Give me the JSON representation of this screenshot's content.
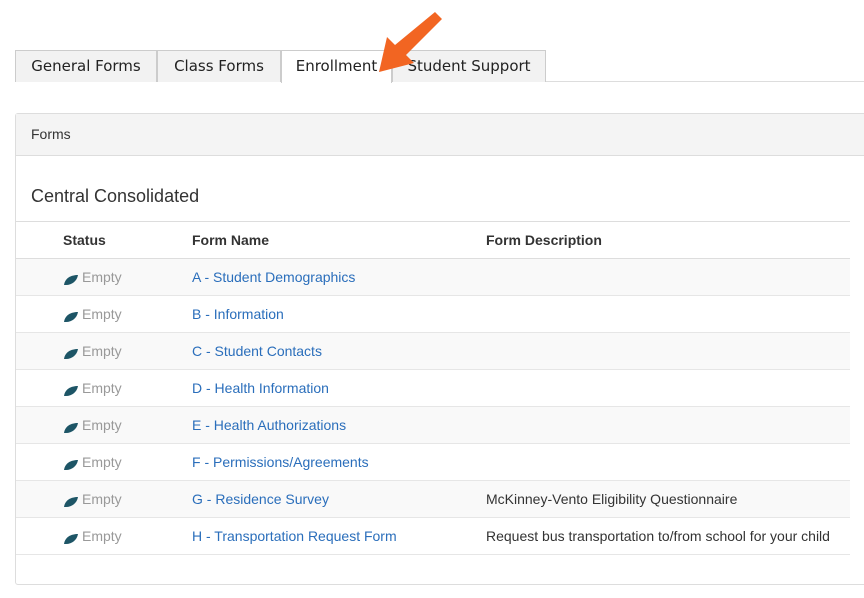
{
  "tabs": [
    {
      "label": "General Forms"
    },
    {
      "label": "Class Forms"
    },
    {
      "label": "Enrollment"
    },
    {
      "label": "Student Support"
    }
  ],
  "active_tab": "Enrollment",
  "panel": {
    "heading": "Forms",
    "district": "Central Consolidated"
  },
  "table": {
    "headers": {
      "status": "Status",
      "name": "Form Name",
      "description": "Form Description"
    },
    "rows": [
      {
        "status": "Empty",
        "name": "A - Student Demographics",
        "description": ""
      },
      {
        "status": "Empty",
        "name": "B - Information",
        "description": ""
      },
      {
        "status": "Empty",
        "name": "C - Student Contacts",
        "description": ""
      },
      {
        "status": "Empty",
        "name": "D - Health Information",
        "description": ""
      },
      {
        "status": "Empty",
        "name": "E - Health Authorizations",
        "description": ""
      },
      {
        "status": "Empty",
        "name": "F - Permissions/Agreements",
        "description": ""
      },
      {
        "status": "Empty",
        "name": "G - Residence Survey",
        "description": "McKinney-Vento Eligibility Questionnaire"
      },
      {
        "status": "Empty",
        "name": "H - Transportation Request Form",
        "description": "Request bus transportation to/from school for your child"
      }
    ]
  },
  "icons": {
    "status": "leaf-icon",
    "annotation": "arrow-pointer-icon"
  },
  "colors": {
    "link": "#2a6ebb",
    "leaf": "#1d5566",
    "annotation_arrow": "#f26522"
  }
}
